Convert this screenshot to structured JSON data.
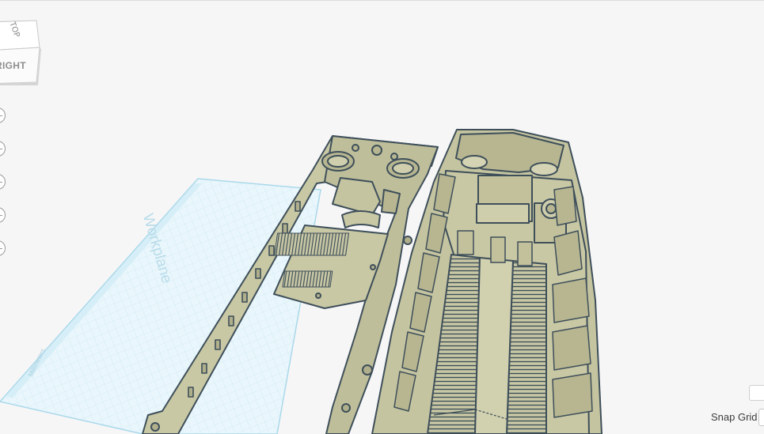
{
  "viewcube": {
    "top_label": "TOP",
    "right_label": "RIGHT"
  },
  "workplane": {
    "label": "Workplane",
    "units": "Millimeters"
  },
  "view_controls": [
    {
      "icon": "home-view-icon"
    },
    {
      "icon": "fit-view-icon"
    },
    {
      "icon": "zoom-in-icon"
    },
    {
      "icon": "zoom-out-icon"
    },
    {
      "icon": "perspective-icon"
    }
  ],
  "snap_grid": {
    "label": "Snap Grid",
    "value": ""
  },
  "colors": {
    "background": "#f6f6f7",
    "workplane_fill": "#e8f6fb",
    "workplane_grid": "#bfe4f2",
    "model_fill": "#c9c8a5",
    "model_outline": "#3e4f5a"
  }
}
